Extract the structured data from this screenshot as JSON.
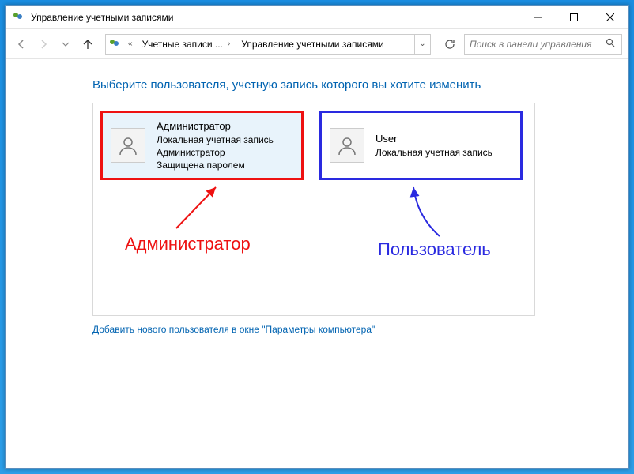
{
  "window": {
    "title": "Управление учетными записями"
  },
  "nav": {
    "breadcrumb": {
      "seg1": "Учетные записи ...",
      "seg2": "Управление учетными записями"
    },
    "search_placeholder": "Поиск в панели управления"
  },
  "main": {
    "heading": "Выберите пользователя, учетную запись которого вы хотите изменить",
    "users": [
      {
        "name": "Администратор",
        "line2": "Локальная учетная запись",
        "line3": "Администратор",
        "line4": "Защищена паролем"
      },
      {
        "name": "User",
        "line2": "Локальная учетная запись",
        "line3": "",
        "line4": ""
      }
    ],
    "annotation_admin": "Администратор",
    "annotation_user": "Пользователь",
    "add_user_link": "Добавить нового пользователя в окне \"Параметры компьютера\""
  },
  "colors": {
    "accent": "#0063b1",
    "highlight_red": "#e11",
    "highlight_blue": "#2a2ae0"
  }
}
